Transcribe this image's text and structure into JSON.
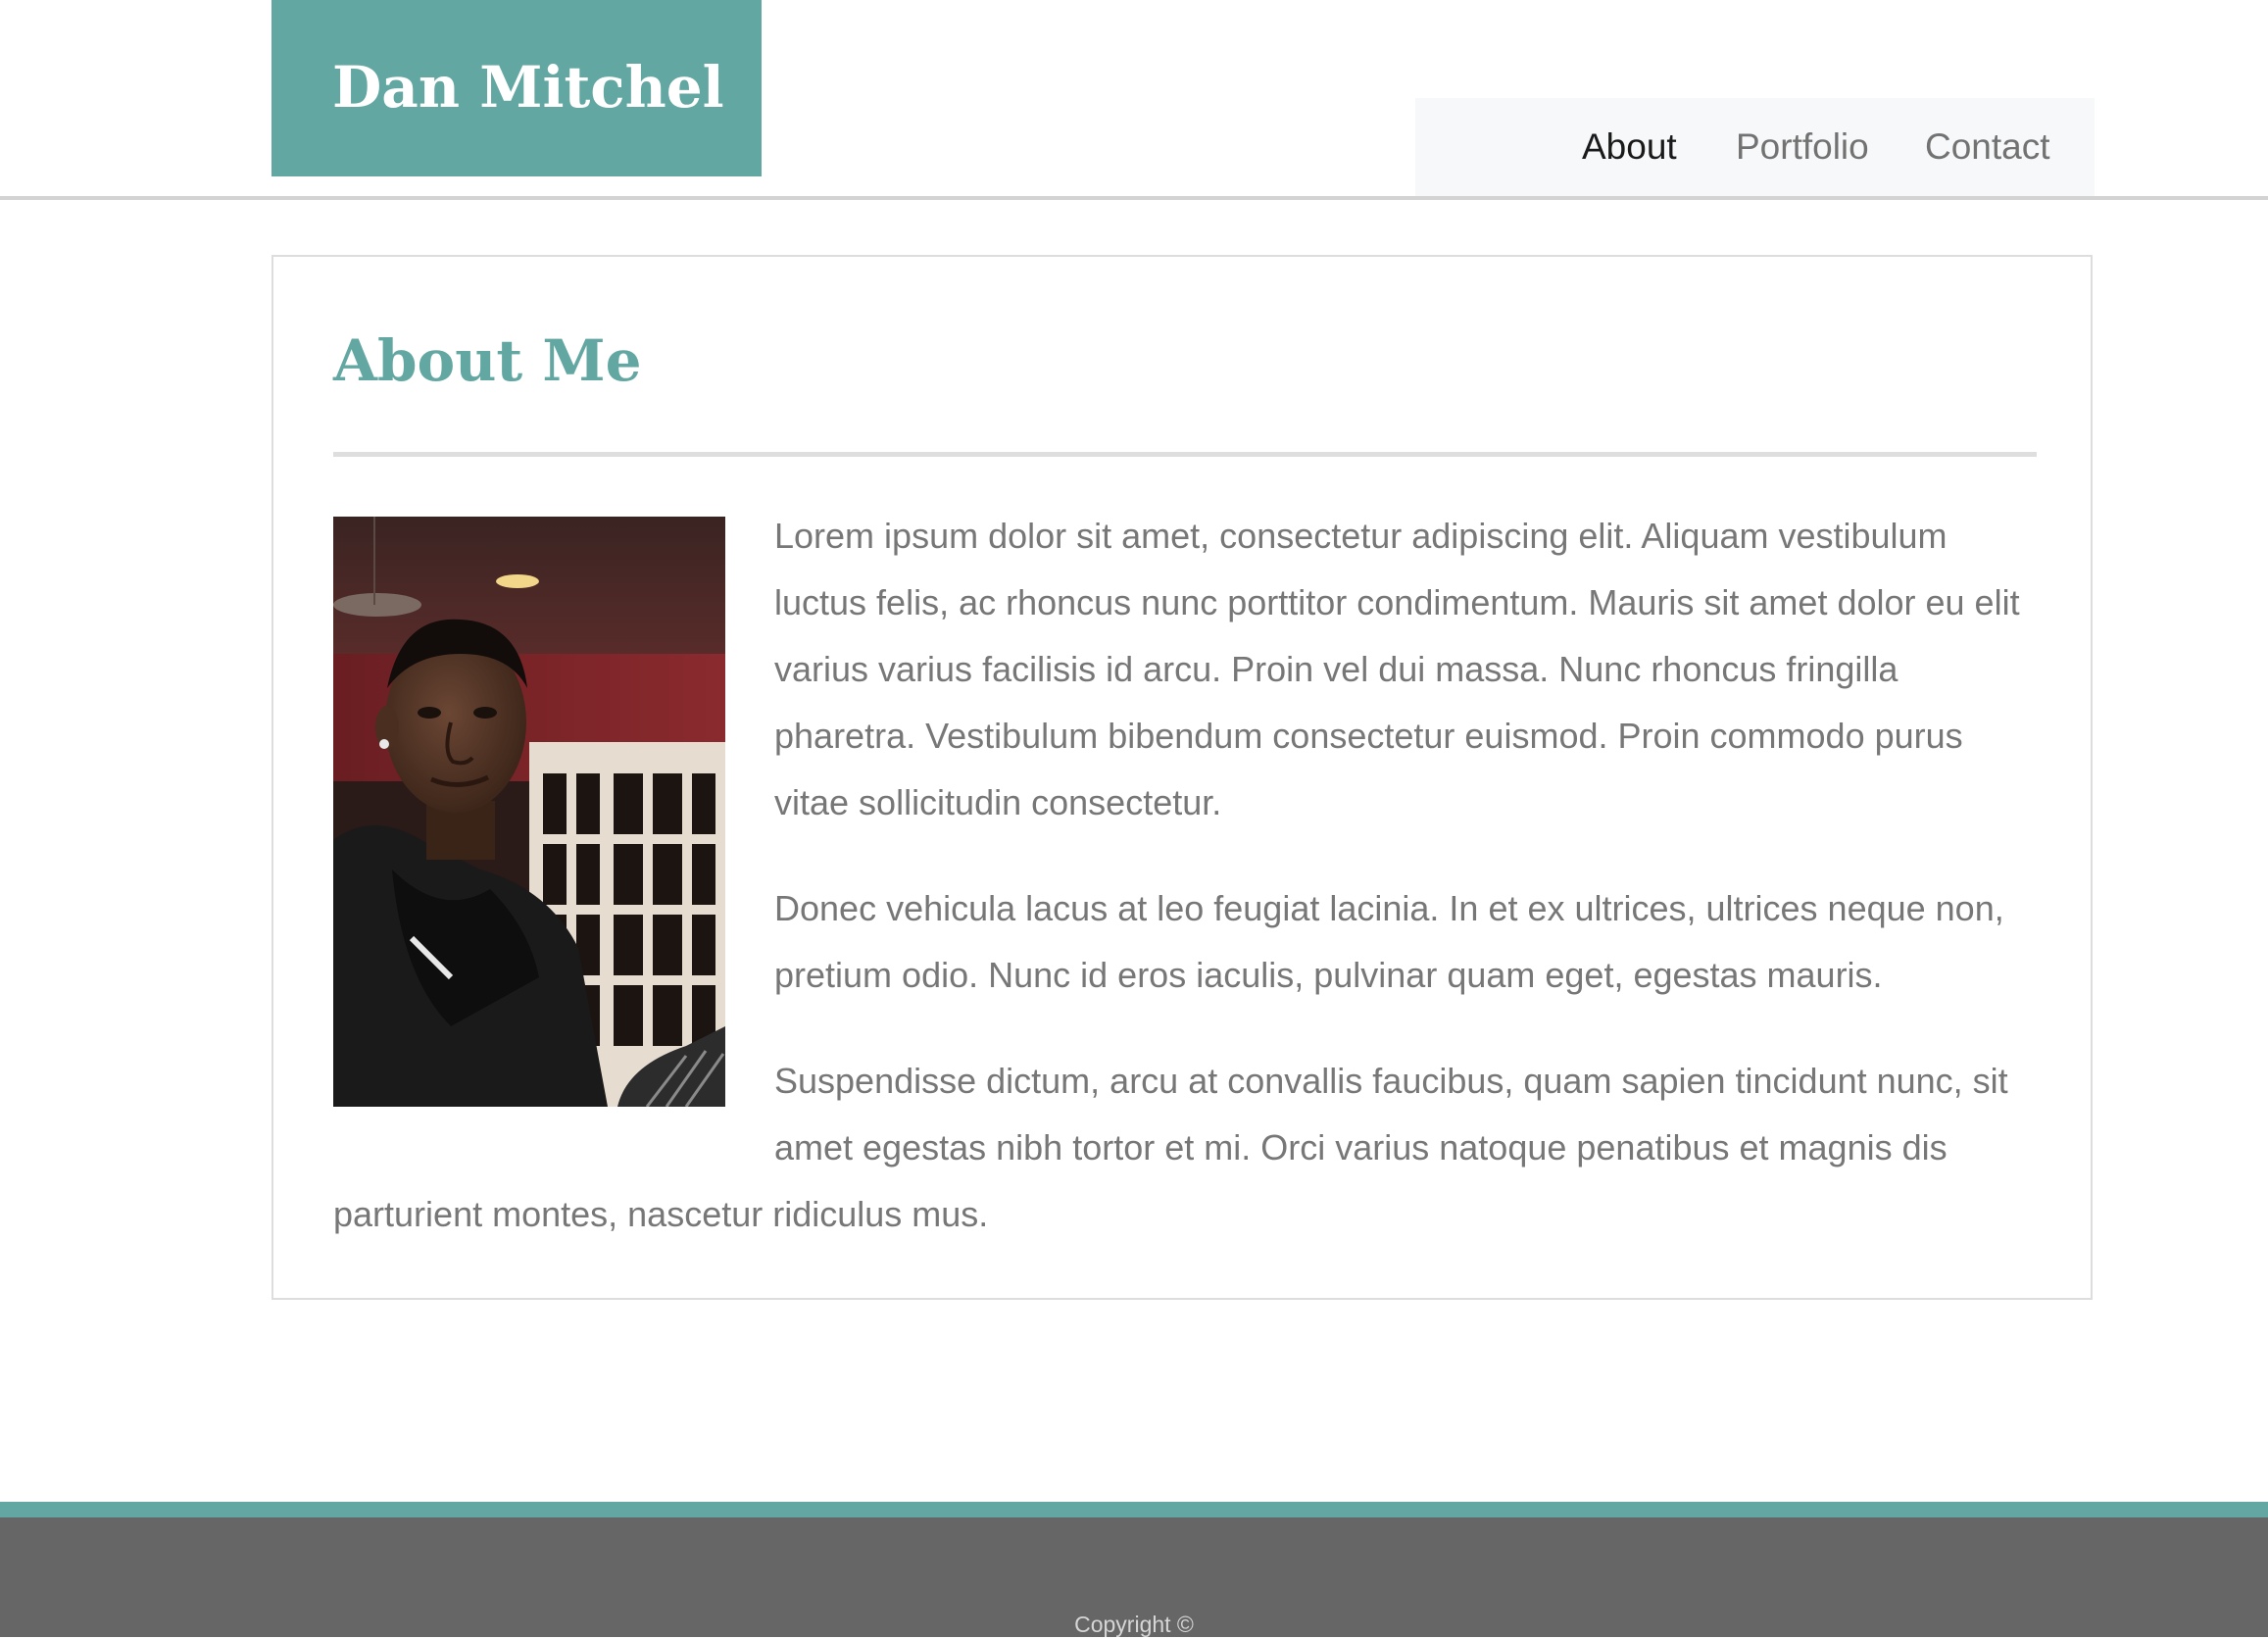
{
  "header": {
    "site_title": "Dan Mitchel"
  },
  "nav": {
    "items": [
      {
        "label": "About",
        "active": true
      },
      {
        "label": "Portfolio",
        "active": false
      },
      {
        "label": "Contact",
        "active": false
      }
    ]
  },
  "main": {
    "heading": "About Me",
    "paragraphs": [
      "Lorem ipsum dolor sit amet, consectetur adipiscing elit. Aliquam vestibulum luctus felis, ac rhoncus nunc porttitor condimentum. Mauris sit amet dolor eu elit varius varius facilisis id arcu. Proin vel dui massa. Nunc rhoncus fringilla pharetra. Vestibulum bibendum consectetur euismod. Proin commodo purus vitae sollicitudin consectetur.",
      "Donec vehicula lacus at leo feugiat lacinia. In et ex ultrices, ultrices neque non, pretium odio. Nunc id eros iaculis, pulvinar quam eget, egestas mauris.",
      "Suspendisse dictum, arcu at convallis faucibus, quam sapien tincidunt nunc, sit amet egestas nibh tortor et mi. Orci varius natoque penatibus et magnis dis parturient montes, nascetur ridiculus mus."
    ]
  },
  "footer": {
    "copyright": "Copyright ©"
  },
  "colors": {
    "accent": "#63a7a2",
    "footer_bg": "#666666",
    "body_text": "#777777",
    "nav_active": "#1a1a1a",
    "nav_inactive": "#727272"
  }
}
